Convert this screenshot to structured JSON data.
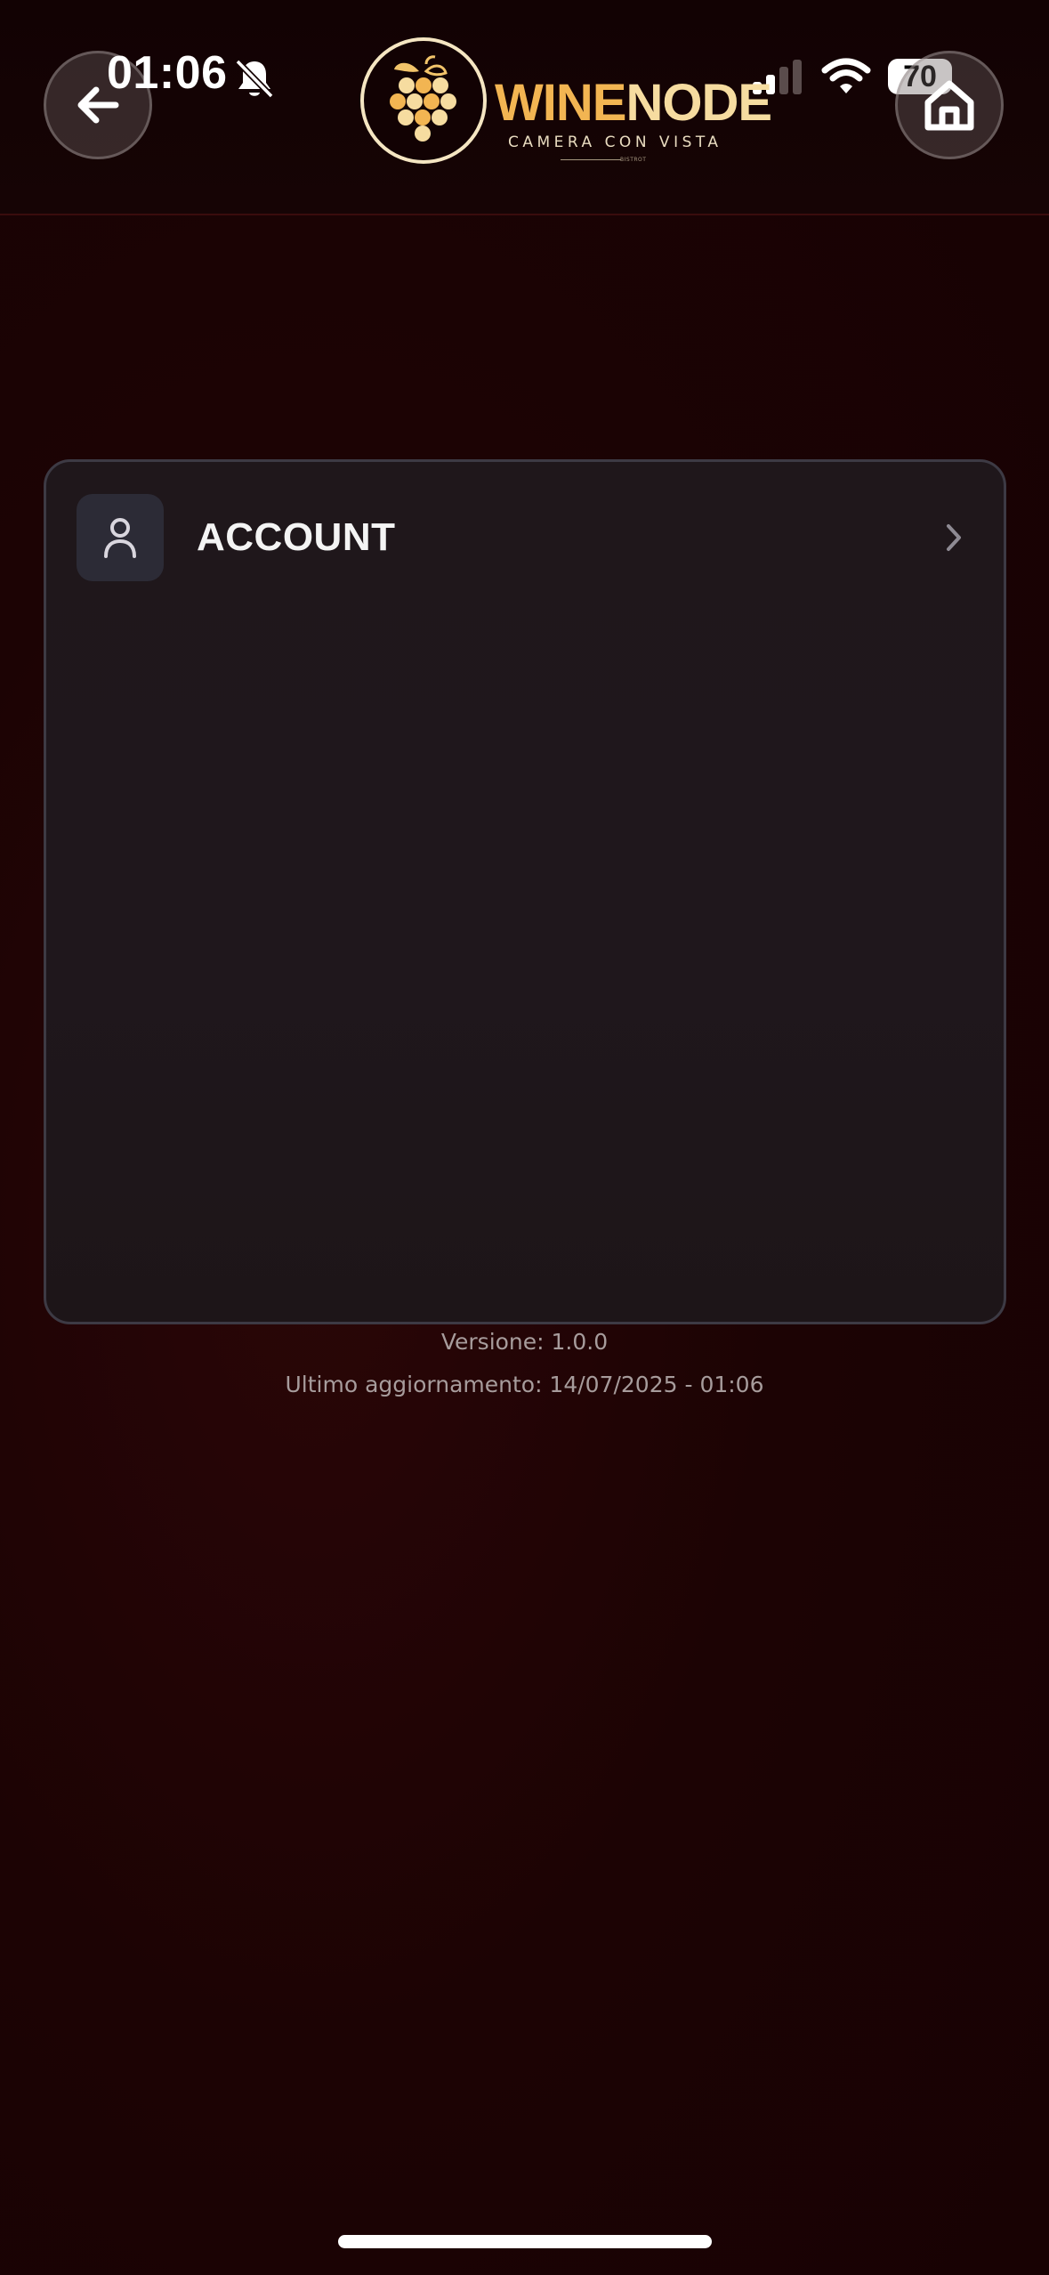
{
  "status_bar": {
    "time": "01:06",
    "battery": "70",
    "bell_icon": "bell-slash-icon",
    "signal_icon": "cellular-signal-icon",
    "wifi_icon": "wifi-icon"
  },
  "header": {
    "logo": {
      "brand_part1": "WINE",
      "brand_part2": "NODE",
      "tagline": "CAMERA CON VISTA",
      "small_text": "BISTROT",
      "icon": "grapes-icon"
    },
    "back_icon": "arrow-left-icon",
    "home_icon": "home-icon"
  },
  "menu": {
    "items": [
      {
        "label": "ACCOUNT",
        "icon": "user-icon",
        "trailing_icon": "chevron-right-icon"
      }
    ]
  },
  "footer": {
    "version": "Versione: 1.0.0",
    "last_update": "Ultimo aggiornamento: 14/07/2025 - 01:06"
  },
  "colors": {
    "background": "#1c0304",
    "card": "#1f171b",
    "brand_gold": "#f2b552",
    "brand_cream": "#f6dca0",
    "muted_text": "#a79c9c"
  }
}
